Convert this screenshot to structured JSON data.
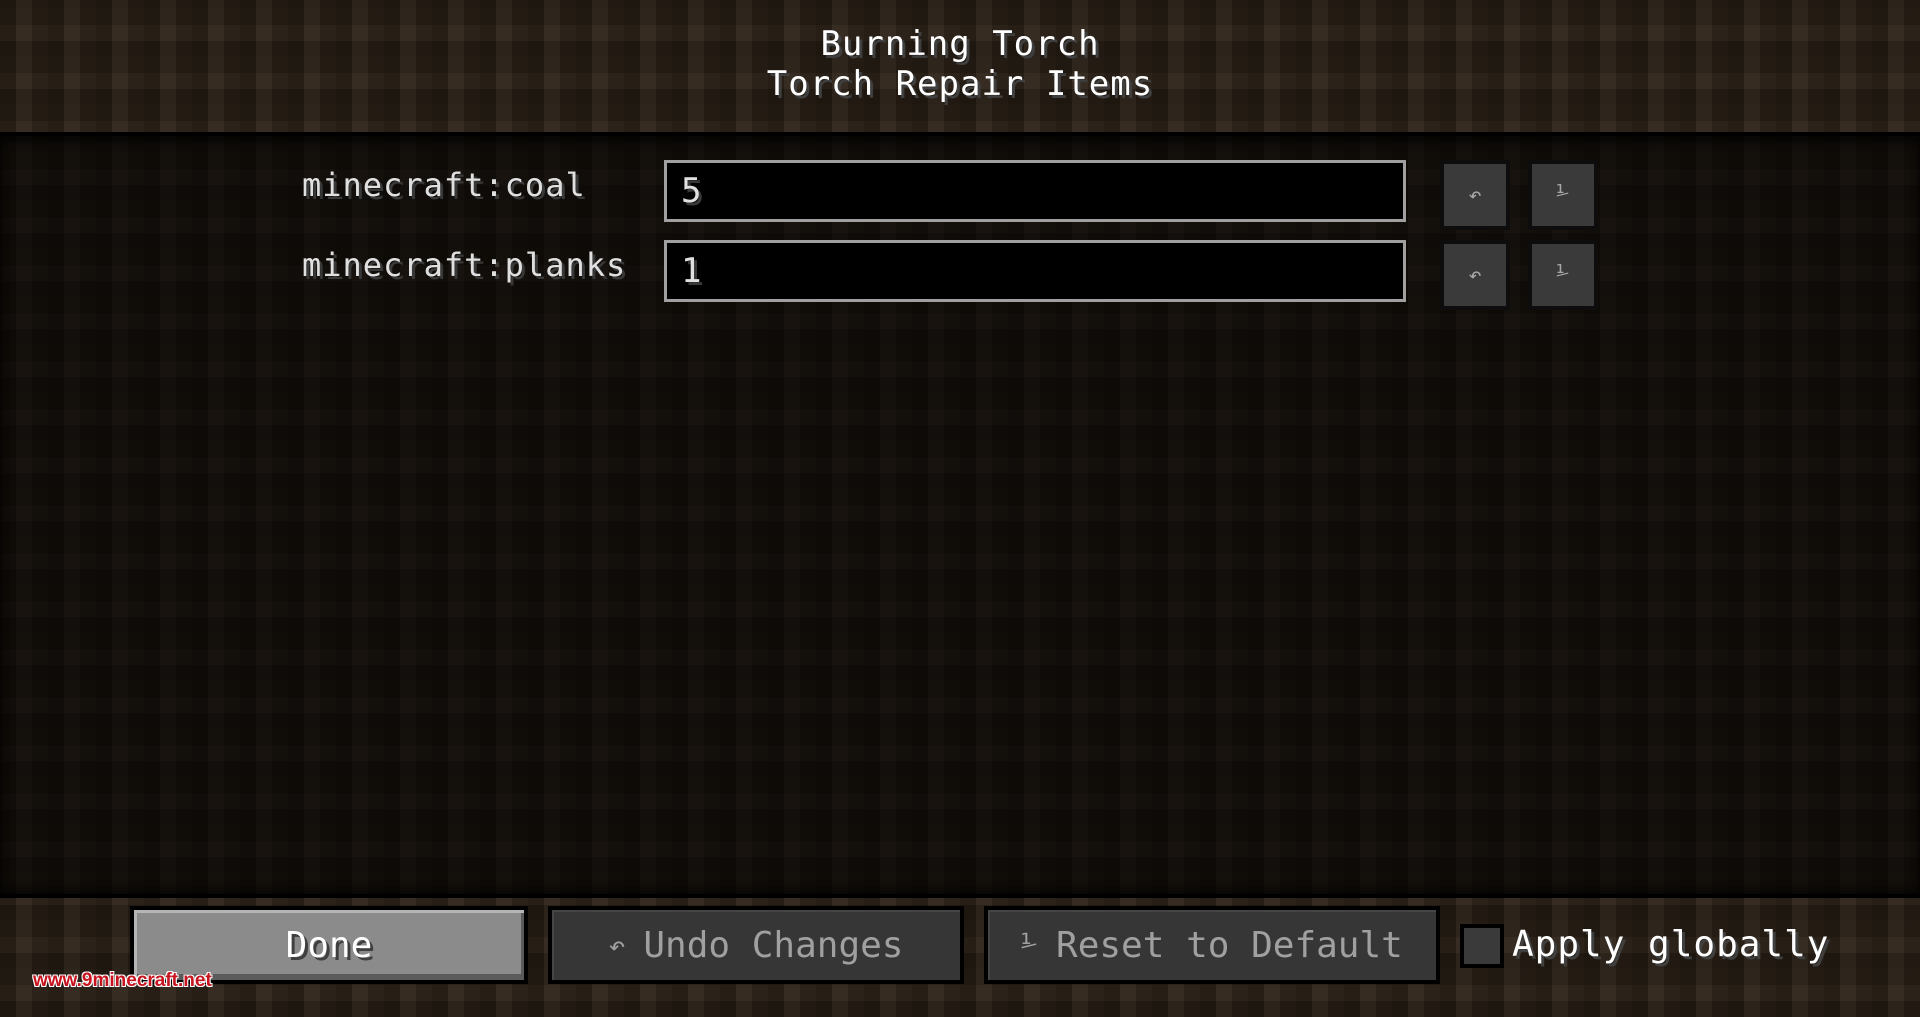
{
  "header": {
    "mod_title": "Burning Torch",
    "screen_title": "Torch Repair Items"
  },
  "entries": [
    {
      "key": "minecraft:coal",
      "value": "5",
      "undo_icon": "undo-arrow-icon",
      "reset_icon": "reset-default-icon"
    },
    {
      "key": "minecraft:planks",
      "value": "1",
      "undo_icon": "undo-arrow-icon",
      "reset_icon": "reset-default-icon"
    }
  ],
  "icons": {
    "undo": "↶",
    "reset": "⅟"
  },
  "footer": {
    "done_label": "Done",
    "undo_label": "Undo Changes",
    "undo_glyph": "↶",
    "reset_label": "Reset to Default",
    "reset_glyph": "⅟",
    "apply_globally_label": "Apply globally",
    "apply_globally_checked": false
  },
  "watermark": "www.9minecraft.net"
}
